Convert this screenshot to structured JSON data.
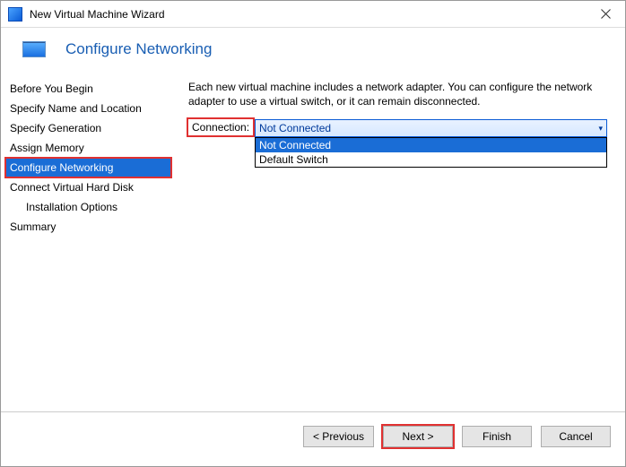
{
  "window": {
    "title": "New Virtual Machine Wizard"
  },
  "header": {
    "title": "Configure Networking"
  },
  "sidebar": {
    "items": [
      {
        "label": "Before You Begin"
      },
      {
        "label": "Specify Name and Location"
      },
      {
        "label": "Specify Generation"
      },
      {
        "label": "Assign Memory"
      },
      {
        "label": "Configure Networking",
        "selected": true,
        "highlight": true
      },
      {
        "label": "Connect Virtual Hard Disk"
      },
      {
        "label": "Installation Options",
        "indent": true
      },
      {
        "label": "Summary"
      }
    ]
  },
  "main": {
    "intro": "Each new virtual machine includes a network adapter. You can configure the network adapter to use a virtual switch, or it can remain disconnected.",
    "connection": {
      "label": "Connection:",
      "selected": "Not Connected",
      "options": [
        "Not Connected",
        "Default Switch"
      ]
    }
  },
  "footer": {
    "previous": "< Previous",
    "next": "Next >",
    "finish": "Finish",
    "cancel": "Cancel"
  }
}
